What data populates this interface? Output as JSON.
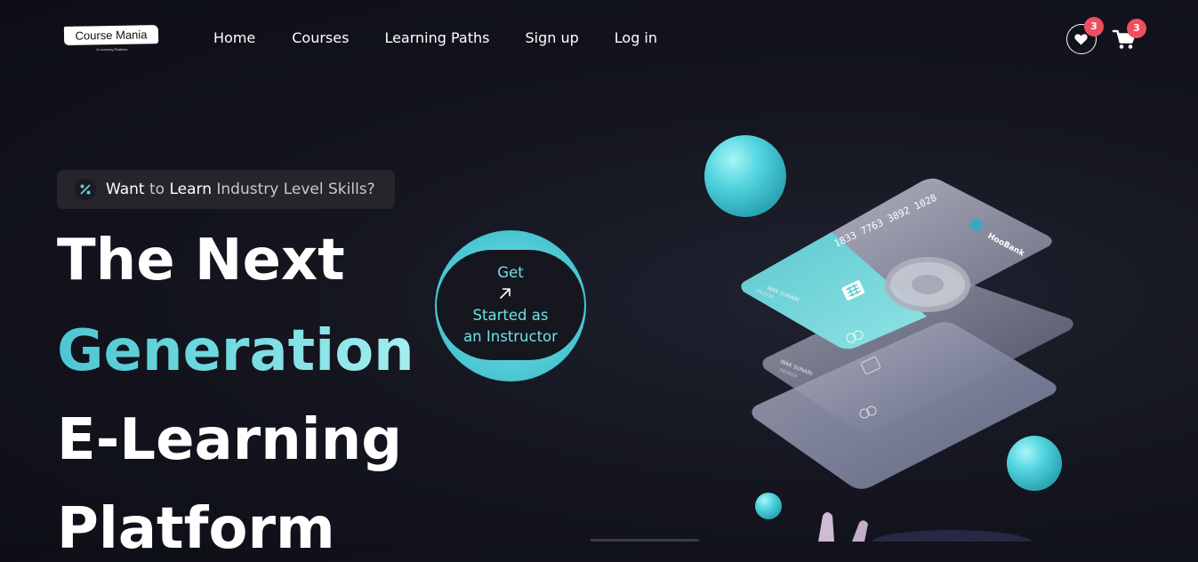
{
  "brand": {
    "name": "Course Mania",
    "tagline": "A Learning Platform"
  },
  "nav": {
    "items": [
      {
        "label": "Home"
      },
      {
        "label": "Courses"
      },
      {
        "label": "Learning Paths"
      },
      {
        "label": "Sign up"
      },
      {
        "label": "Log in"
      }
    ]
  },
  "header_icons": {
    "wishlist": {
      "icon": "heart-icon",
      "count": "3"
    },
    "cart": {
      "icon": "cart-icon",
      "count": "3"
    }
  },
  "hero": {
    "pill": {
      "icon": "percent-icon",
      "w1": "Want",
      "w2": " to ",
      "w3": "Learn",
      "w4": " Industry Level Skills?"
    },
    "headline": {
      "line1": "The Next",
      "line2": "Generation",
      "line3": "E-Learning",
      "line4": "Platform"
    },
    "cta": {
      "line1": "Get",
      "line2": "Started as",
      "line3": "an Instructor",
      "icon": "arrow-up-right-icon"
    }
  },
  "illustration": {
    "card_number": "1833 7763 3892 1028",
    "card_brand": "HooBank",
    "holder": "WAK SUNARI",
    "expiry": "08/2024"
  },
  "colors": {
    "background": "#14151f",
    "accent": "#5cd3dc",
    "badge": "#ee4f5f",
    "pill_bg": "#26252c"
  }
}
